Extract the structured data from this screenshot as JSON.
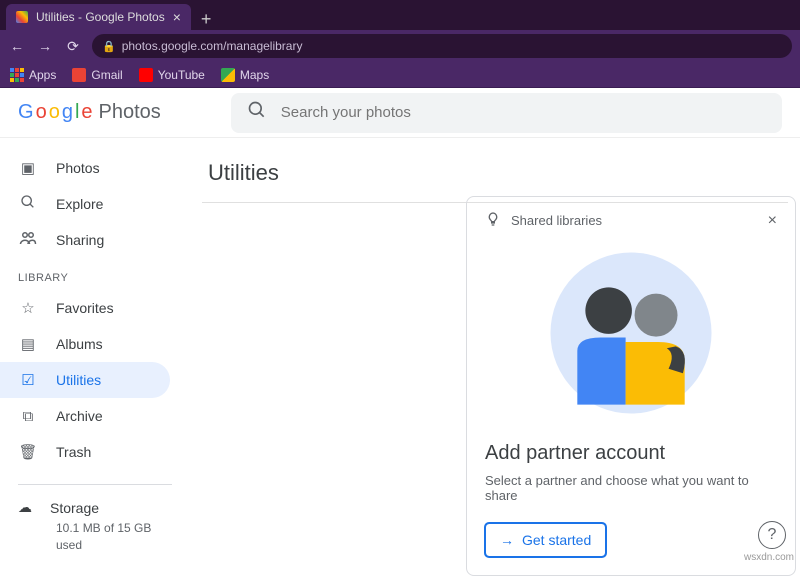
{
  "browser": {
    "tab_title": "Utilities - Google Photos",
    "url": "photos.google.com/managelibrary",
    "bookmarks": [
      {
        "label": "Apps"
      },
      {
        "label": "Gmail"
      },
      {
        "label": "YouTube"
      },
      {
        "label": "Maps"
      }
    ]
  },
  "header": {
    "product": "Photos",
    "search_placeholder": "Search your photos"
  },
  "sidebar": {
    "items": [
      {
        "label": "Photos",
        "icon": "photo-icon"
      },
      {
        "label": "Explore",
        "icon": "search-icon"
      },
      {
        "label": "Sharing",
        "icon": "people-icon"
      }
    ],
    "library_label": "LIBRARY",
    "library_items": [
      {
        "label": "Favorites",
        "icon": "star-icon"
      },
      {
        "label": "Albums",
        "icon": "album-icon"
      },
      {
        "label": "Utilities",
        "icon": "check-box-icon",
        "active": true
      },
      {
        "label": "Archive",
        "icon": "archive-icon"
      },
      {
        "label": "Trash",
        "icon": "trash-icon"
      }
    ],
    "storage": {
      "label": "Storage",
      "detail": "10.1 MB of 15 GB used"
    }
  },
  "main": {
    "title": "Utilities",
    "card": {
      "hint_label": "Shared libraries",
      "heading": "Add partner account",
      "body": "Select a partner and choose what you want to share",
      "cta": "Get started"
    }
  },
  "watermark": "wsxdn.com"
}
